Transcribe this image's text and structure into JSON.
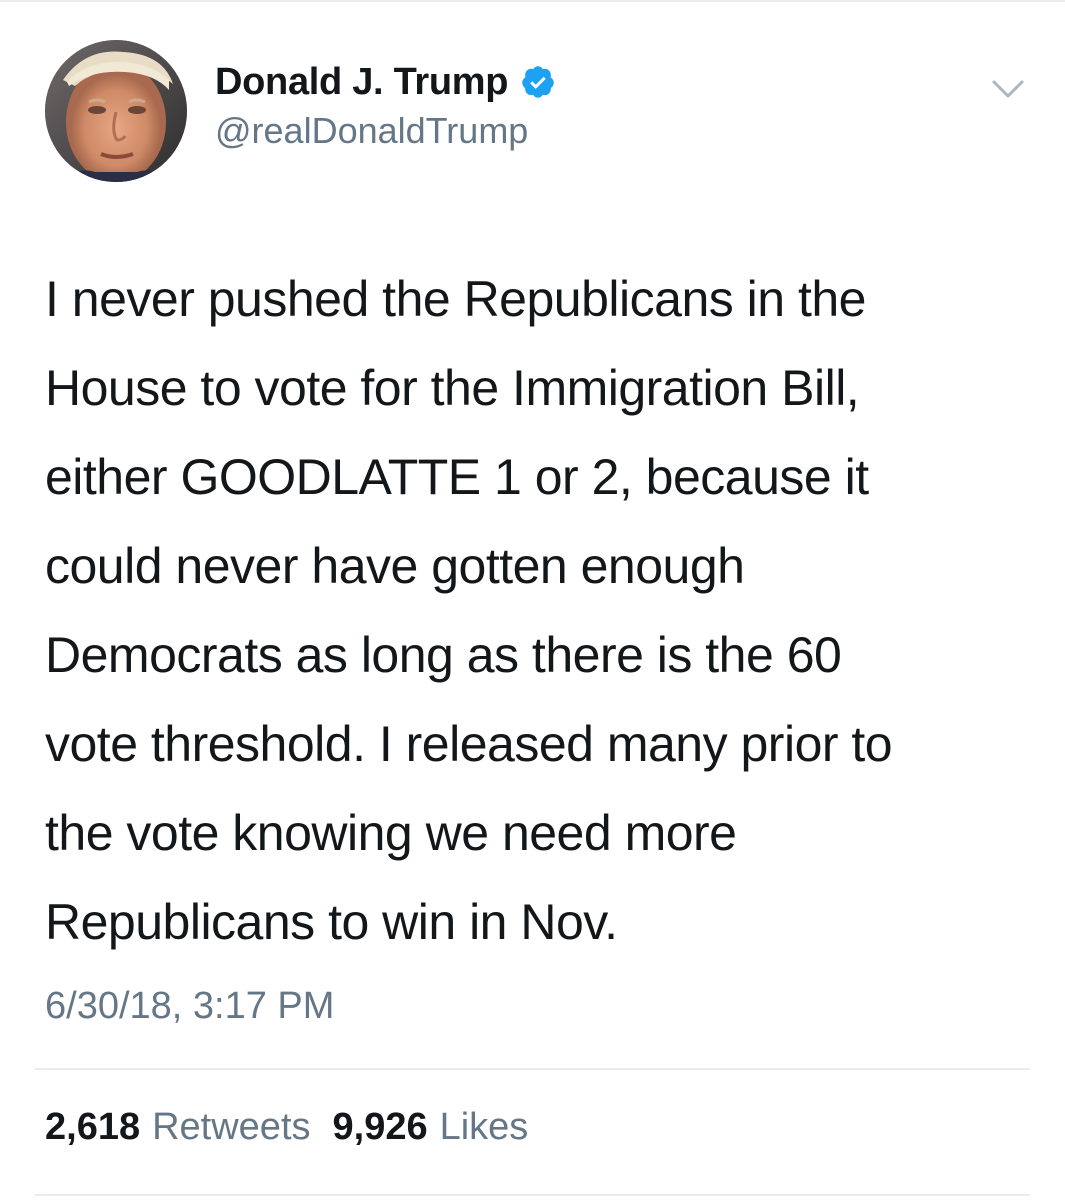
{
  "author": {
    "display_name": "Donald J. Trump",
    "handle": "@realDonaldTrump",
    "verified": true,
    "avatar_icon": "profile-photo"
  },
  "tweet": {
    "lines": [
      "I never pushed the Republicans in the",
      "House to vote for the Immigration Bill,",
      "either GOODLATTE 1 or 2, because it",
      "could never have gotten enough",
      "Democrats as long as there is the 60",
      "vote threshold. I released many prior to",
      "the vote knowing we need more",
      "Republicans to win in Nov."
    ],
    "timestamp": "6/30/18, 3:17 PM"
  },
  "stats": {
    "retweets_count": "2,618",
    "retweets_label": "Retweets",
    "likes_count": "9,926",
    "likes_label": "Likes"
  },
  "colors": {
    "verified_blue": "#1da1f2",
    "secondary_text": "#657786",
    "primary_text": "#14171a",
    "divider": "#e6ecf0"
  }
}
